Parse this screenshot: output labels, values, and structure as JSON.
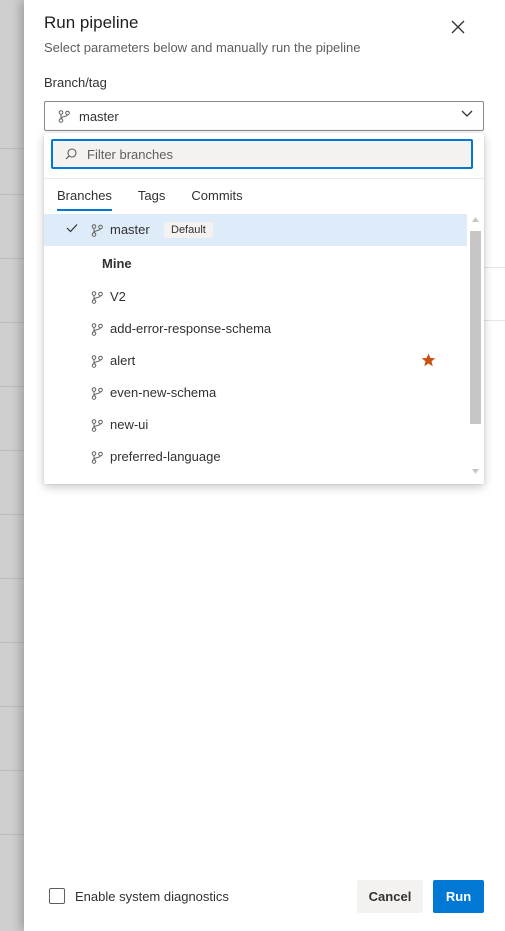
{
  "panel": {
    "title": "Run pipeline",
    "subtitle": "Select parameters below and manually run the pipeline"
  },
  "branch_field": {
    "label": "Branch/tag",
    "value": "master"
  },
  "dropdown": {
    "search_placeholder": "Filter branches",
    "tabs": [
      "Branches",
      "Tags",
      "Commits"
    ],
    "active_tab": "Branches",
    "default_branch": {
      "name": "master",
      "badge": "Default",
      "selected": true
    },
    "section_mine": "Mine",
    "mine_branches": [
      {
        "name": "V2",
        "favorite": false
      },
      {
        "name": "add-error-response-schema",
        "favorite": false
      },
      {
        "name": "alert",
        "favorite": true
      },
      {
        "name": "even-new-schema",
        "favorite": false
      },
      {
        "name": "new-ui",
        "favorite": false
      },
      {
        "name": "preferred-language",
        "favorite": false
      }
    ]
  },
  "footer": {
    "diagnostics_label": "Enable system diagnostics",
    "diagnostics_checked": false,
    "cancel_label": "Cancel",
    "run_label": "Run"
  },
  "colors": {
    "accent": "#0078d4",
    "selected_row": "#deecf9",
    "favorite_star": "#ca5010"
  }
}
